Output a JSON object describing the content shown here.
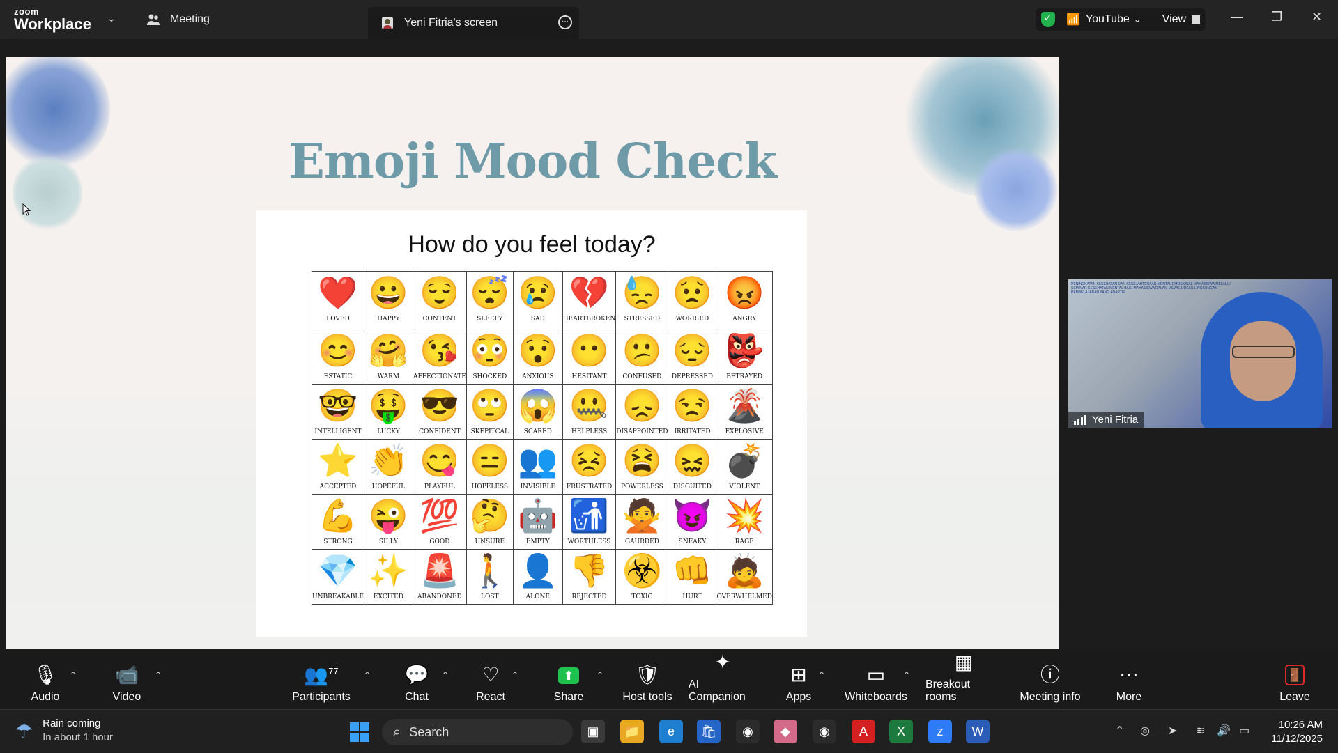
{
  "app": {
    "logo_small": "zoom",
    "logo_big": "Workplace",
    "meeting_tab": "Meeting",
    "share_tab": "Yeni Fitria's screen",
    "audio_source": "YouTube",
    "view_label": "View"
  },
  "slide": {
    "title": "Emoji Mood Check",
    "question": "How do you feel today?",
    "rows": [
      [
        {
          "e": "❤️",
          "l": "LOVED"
        },
        {
          "e": "😀",
          "l": "HAPPY"
        },
        {
          "e": "😌",
          "l": "CONTENT"
        },
        {
          "e": "😴",
          "l": "SLEEPY"
        },
        {
          "e": "😢",
          "l": "SAD"
        },
        {
          "e": "💔",
          "l": "HEARTBROKEN"
        },
        {
          "e": "😓",
          "l": "STRESSED"
        },
        {
          "e": "😟",
          "l": "WORRIED"
        },
        {
          "e": "😡",
          "l": "ANGRY"
        }
      ],
      [
        {
          "e": "😊",
          "l": "ESTATIC"
        },
        {
          "e": "🤗",
          "l": "WARM"
        },
        {
          "e": "😘",
          "l": "AFFECTIONATE"
        },
        {
          "e": "😳",
          "l": "SHOCKED"
        },
        {
          "e": "😯",
          "l": "ANXIOUS"
        },
        {
          "e": "😶",
          "l": "HESITANT"
        },
        {
          "e": "😕",
          "l": "CONFUSED"
        },
        {
          "e": "😔",
          "l": "DEPRESSED"
        },
        {
          "e": "👺",
          "l": "BETRAYED"
        }
      ],
      [
        {
          "e": "🤓",
          "l": "INTELLIGENT"
        },
        {
          "e": "🤑",
          "l": "LUCKY"
        },
        {
          "e": "😎",
          "l": "CONFIDENT"
        },
        {
          "e": "🙄",
          "l": "SKEPITCAL"
        },
        {
          "e": "😱",
          "l": "SCARED"
        },
        {
          "e": "🤐",
          "l": "HELPLESS"
        },
        {
          "e": "😞",
          "l": "DISAPPOINTED"
        },
        {
          "e": "😒",
          "l": "IRRITATED"
        },
        {
          "e": "🌋",
          "l": "EXPLOSIVE"
        }
      ],
      [
        {
          "e": "⭐",
          "l": "ACCEPTED"
        },
        {
          "e": "👏",
          "l": "HOPEFUL"
        },
        {
          "e": "😋",
          "l": "PLAYFUL"
        },
        {
          "e": "😑",
          "l": "HOPELESS"
        },
        {
          "e": "👥",
          "l": "INVISIBLE"
        },
        {
          "e": "😣",
          "l": "FRUSTRATED"
        },
        {
          "e": "😫",
          "l": "POWERLESS"
        },
        {
          "e": "😖",
          "l": "DISGUITED"
        },
        {
          "e": "💣",
          "l": "VIOLENT"
        }
      ],
      [
        {
          "e": "💪",
          "l": "STRONG"
        },
        {
          "e": "😜",
          "l": "SILLY"
        },
        {
          "e": "💯",
          "l": "GOOD"
        },
        {
          "e": "🤔",
          "l": "UNSURE"
        },
        {
          "e": "🤖",
          "l": "EMPTY"
        },
        {
          "e": "🚮",
          "l": "WORTHLESS"
        },
        {
          "e": "🙅",
          "l": "GAURDED"
        },
        {
          "e": "😈",
          "l": "SNEAKY"
        },
        {
          "e": "💥",
          "l": "RAGE"
        }
      ],
      [
        {
          "e": "💎",
          "l": "UNBREAKABLE"
        },
        {
          "e": "✨",
          "l": "EXCITED"
        },
        {
          "e": "🚨",
          "l": "ABANDONED"
        },
        {
          "e": "🚶",
          "l": "LOST"
        },
        {
          "e": "👤",
          "l": "ALONE"
        },
        {
          "e": "👎",
          "l": "REJECTED"
        },
        {
          "e": "☣️",
          "l": "TOXIC"
        },
        {
          "e": "👊",
          "l": "HURT"
        },
        {
          "e": "🙇",
          "l": "OVERWHELMED"
        }
      ]
    ]
  },
  "video": {
    "name": "Yeni Fitria",
    "banner_text": "PENINGKATAN KESEHATAN DAN KESEJAHTERAAN MENTAL EMOSIONAL MAHASISWA MELALUI SEMINAR KESEHATAN MENTAL BAGI MAHASISWA DALAM MEWUJUDKAN LINGKUNGAN PEMBELAJARAN YANG ADAPTIF"
  },
  "toolbar": {
    "audio": "Audio",
    "video": "Video",
    "participants": "Participants",
    "participants_count": "77",
    "chat": "Chat",
    "react": "React",
    "share": "Share",
    "host_tools": "Host tools",
    "ai_companion": "AI Companion",
    "apps": "Apps",
    "whiteboards": "Whiteboards",
    "breakout_rooms": "Breakout rooms",
    "meeting_info": "Meeting info",
    "more": "More",
    "leave": "Leave"
  },
  "taskbar": {
    "weather_title": "Rain coming",
    "weather_sub": "In about 1 hour",
    "search_placeholder": "Search",
    "time": "10:26 AM",
    "date": "11/12/2025"
  },
  "colors": {
    "title": "#6f9aa7",
    "share_green": "#1ec24f",
    "leave_red": "#e02828",
    "shield_green": "#22b14c"
  }
}
